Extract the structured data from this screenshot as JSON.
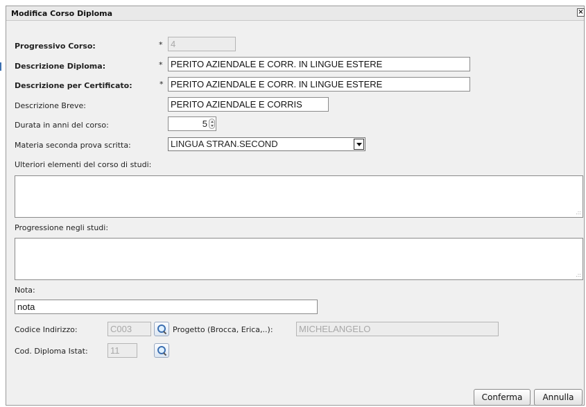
{
  "dialog": {
    "title": "Modifica Corso Diploma",
    "close_glyph": "×"
  },
  "form": {
    "required_marker": "*",
    "progressivo": {
      "label": "Progressivo Corso:",
      "value": "4"
    },
    "descrizione_diploma": {
      "label": "Descrizione Diploma:",
      "value": "PERITO AZIENDALE E CORR. IN LINGUE ESTERE"
    },
    "descrizione_certificato": {
      "label": "Descrizione per Certificato:",
      "value": "PERITO AZIENDALE E CORR. IN LINGUE ESTERE"
    },
    "descrizione_breve": {
      "label": "Descrizione Breve:",
      "value": "PERITO AZIENDALE E CORRIS"
    },
    "durata": {
      "label": "Durata in anni del corso:",
      "value": "5"
    },
    "materia": {
      "label": "Materia seconda prova scritta:",
      "selected": "LINGUA STRAN.SECOND"
    },
    "ulteriori": {
      "label": "Ulteriori elementi del corso di studi:",
      "value": ""
    },
    "progressione": {
      "label": "Progressione negli studi:",
      "value": ""
    },
    "nota": {
      "label": "Nota:",
      "value": "nota"
    },
    "codice_indirizzo": {
      "label": "Codice Indirizzo:",
      "value": "C003"
    },
    "progetto": {
      "label": "Progetto (Brocca, Erica,..):",
      "value": "MICHELANGELO"
    },
    "cod_diploma_istat": {
      "label": "Cod. Diploma Istat:",
      "value": "11"
    }
  },
  "buttons": {
    "confirm": "Conferma",
    "cancel": "Annulla"
  },
  "icons": {
    "lookup": "magnifier-icon",
    "close": "close-icon",
    "resize": "resize-grip-icon"
  }
}
